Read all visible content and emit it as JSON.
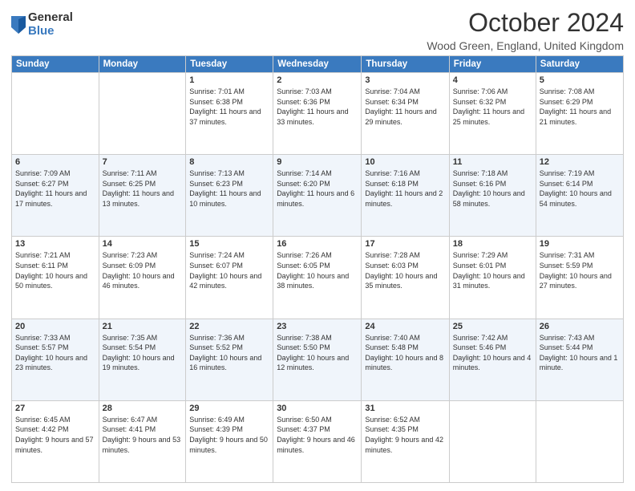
{
  "logo": {
    "general": "General",
    "blue": "Blue"
  },
  "title": "October 2024",
  "location": "Wood Green, England, United Kingdom",
  "days_of_week": [
    "Sunday",
    "Monday",
    "Tuesday",
    "Wednesday",
    "Thursday",
    "Friday",
    "Saturday"
  ],
  "weeks": [
    [
      {
        "num": "",
        "sunrise": "",
        "sunset": "",
        "daylight": ""
      },
      {
        "num": "",
        "sunrise": "",
        "sunset": "",
        "daylight": ""
      },
      {
        "num": "1",
        "sunrise": "Sunrise: 7:01 AM",
        "sunset": "Sunset: 6:38 PM",
        "daylight": "Daylight: 11 hours and 37 minutes."
      },
      {
        "num": "2",
        "sunrise": "Sunrise: 7:03 AM",
        "sunset": "Sunset: 6:36 PM",
        "daylight": "Daylight: 11 hours and 33 minutes."
      },
      {
        "num": "3",
        "sunrise": "Sunrise: 7:04 AM",
        "sunset": "Sunset: 6:34 PM",
        "daylight": "Daylight: 11 hours and 29 minutes."
      },
      {
        "num": "4",
        "sunrise": "Sunrise: 7:06 AM",
        "sunset": "Sunset: 6:32 PM",
        "daylight": "Daylight: 11 hours and 25 minutes."
      },
      {
        "num": "5",
        "sunrise": "Sunrise: 7:08 AM",
        "sunset": "Sunset: 6:29 PM",
        "daylight": "Daylight: 11 hours and 21 minutes."
      }
    ],
    [
      {
        "num": "6",
        "sunrise": "Sunrise: 7:09 AM",
        "sunset": "Sunset: 6:27 PM",
        "daylight": "Daylight: 11 hours and 17 minutes."
      },
      {
        "num": "7",
        "sunrise": "Sunrise: 7:11 AM",
        "sunset": "Sunset: 6:25 PM",
        "daylight": "Daylight: 11 hours and 13 minutes."
      },
      {
        "num": "8",
        "sunrise": "Sunrise: 7:13 AM",
        "sunset": "Sunset: 6:23 PM",
        "daylight": "Daylight: 11 hours and 10 minutes."
      },
      {
        "num": "9",
        "sunrise": "Sunrise: 7:14 AM",
        "sunset": "Sunset: 6:20 PM",
        "daylight": "Daylight: 11 hours and 6 minutes."
      },
      {
        "num": "10",
        "sunrise": "Sunrise: 7:16 AM",
        "sunset": "Sunset: 6:18 PM",
        "daylight": "Daylight: 11 hours and 2 minutes."
      },
      {
        "num": "11",
        "sunrise": "Sunrise: 7:18 AM",
        "sunset": "Sunset: 6:16 PM",
        "daylight": "Daylight: 10 hours and 58 minutes."
      },
      {
        "num": "12",
        "sunrise": "Sunrise: 7:19 AM",
        "sunset": "Sunset: 6:14 PM",
        "daylight": "Daylight: 10 hours and 54 minutes."
      }
    ],
    [
      {
        "num": "13",
        "sunrise": "Sunrise: 7:21 AM",
        "sunset": "Sunset: 6:11 PM",
        "daylight": "Daylight: 10 hours and 50 minutes."
      },
      {
        "num": "14",
        "sunrise": "Sunrise: 7:23 AM",
        "sunset": "Sunset: 6:09 PM",
        "daylight": "Daylight: 10 hours and 46 minutes."
      },
      {
        "num": "15",
        "sunrise": "Sunrise: 7:24 AM",
        "sunset": "Sunset: 6:07 PM",
        "daylight": "Daylight: 10 hours and 42 minutes."
      },
      {
        "num": "16",
        "sunrise": "Sunrise: 7:26 AM",
        "sunset": "Sunset: 6:05 PM",
        "daylight": "Daylight: 10 hours and 38 minutes."
      },
      {
        "num": "17",
        "sunrise": "Sunrise: 7:28 AM",
        "sunset": "Sunset: 6:03 PM",
        "daylight": "Daylight: 10 hours and 35 minutes."
      },
      {
        "num": "18",
        "sunrise": "Sunrise: 7:29 AM",
        "sunset": "Sunset: 6:01 PM",
        "daylight": "Daylight: 10 hours and 31 minutes."
      },
      {
        "num": "19",
        "sunrise": "Sunrise: 7:31 AM",
        "sunset": "Sunset: 5:59 PM",
        "daylight": "Daylight: 10 hours and 27 minutes."
      }
    ],
    [
      {
        "num": "20",
        "sunrise": "Sunrise: 7:33 AM",
        "sunset": "Sunset: 5:57 PM",
        "daylight": "Daylight: 10 hours and 23 minutes."
      },
      {
        "num": "21",
        "sunrise": "Sunrise: 7:35 AM",
        "sunset": "Sunset: 5:54 PM",
        "daylight": "Daylight: 10 hours and 19 minutes."
      },
      {
        "num": "22",
        "sunrise": "Sunrise: 7:36 AM",
        "sunset": "Sunset: 5:52 PM",
        "daylight": "Daylight: 10 hours and 16 minutes."
      },
      {
        "num": "23",
        "sunrise": "Sunrise: 7:38 AM",
        "sunset": "Sunset: 5:50 PM",
        "daylight": "Daylight: 10 hours and 12 minutes."
      },
      {
        "num": "24",
        "sunrise": "Sunrise: 7:40 AM",
        "sunset": "Sunset: 5:48 PM",
        "daylight": "Daylight: 10 hours and 8 minutes."
      },
      {
        "num": "25",
        "sunrise": "Sunrise: 7:42 AM",
        "sunset": "Sunset: 5:46 PM",
        "daylight": "Daylight: 10 hours and 4 minutes."
      },
      {
        "num": "26",
        "sunrise": "Sunrise: 7:43 AM",
        "sunset": "Sunset: 5:44 PM",
        "daylight": "Daylight: 10 hours and 1 minute."
      }
    ],
    [
      {
        "num": "27",
        "sunrise": "Sunrise: 6:45 AM",
        "sunset": "Sunset: 4:42 PM",
        "daylight": "Daylight: 9 hours and 57 minutes."
      },
      {
        "num": "28",
        "sunrise": "Sunrise: 6:47 AM",
        "sunset": "Sunset: 4:41 PM",
        "daylight": "Daylight: 9 hours and 53 minutes."
      },
      {
        "num": "29",
        "sunrise": "Sunrise: 6:49 AM",
        "sunset": "Sunset: 4:39 PM",
        "daylight": "Daylight: 9 hours and 50 minutes."
      },
      {
        "num": "30",
        "sunrise": "Sunrise: 6:50 AM",
        "sunset": "Sunset: 4:37 PM",
        "daylight": "Daylight: 9 hours and 46 minutes."
      },
      {
        "num": "31",
        "sunrise": "Sunrise: 6:52 AM",
        "sunset": "Sunset: 4:35 PM",
        "daylight": "Daylight: 9 hours and 42 minutes."
      },
      {
        "num": "",
        "sunrise": "",
        "sunset": "",
        "daylight": ""
      },
      {
        "num": "",
        "sunrise": "",
        "sunset": "",
        "daylight": ""
      }
    ]
  ]
}
